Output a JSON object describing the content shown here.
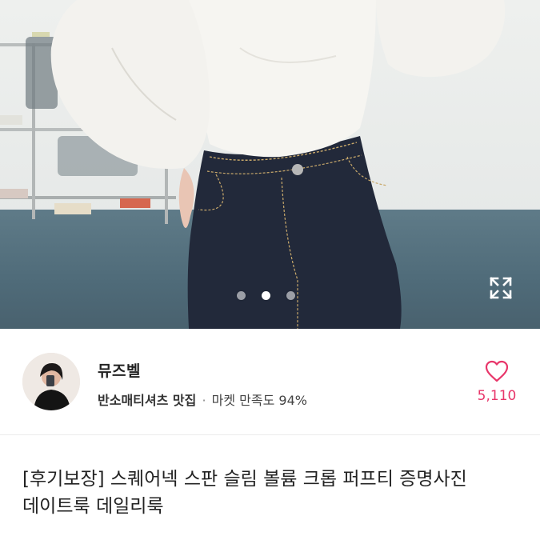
{
  "gallery": {
    "slide_count": 3,
    "active_index": 1
  },
  "icons": {
    "expand": "expand-icon",
    "like": "heart-icon"
  },
  "seller": {
    "name": "뮤즈벨",
    "tagline": "반소매티셔츠 맛집",
    "separator": "·",
    "satisfaction_label": "마켓 만족도 94%"
  },
  "likes": {
    "count": "5,110",
    "color": "#e8366a"
  },
  "product": {
    "title": "[후기보장] 스퀘어넥 스판 슬림 볼륨 크롭 퍼프티 증명사진 데이트룩 데일리룩"
  }
}
